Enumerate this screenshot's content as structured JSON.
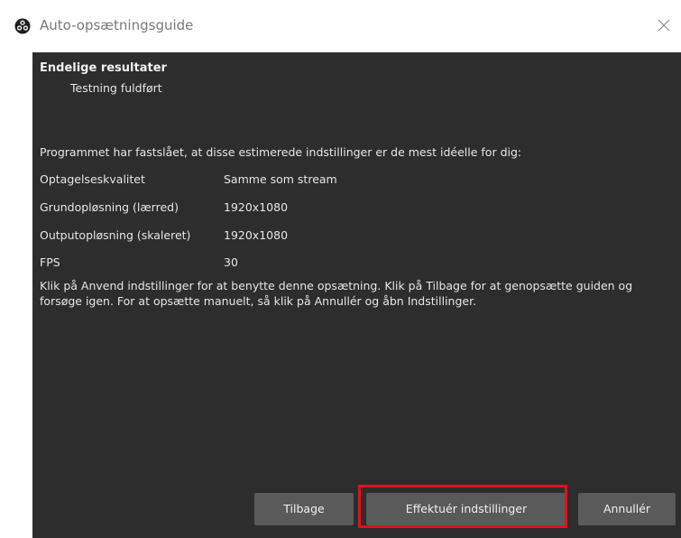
{
  "window": {
    "title": "Auto-opsætningsguide",
    "app_icon": "obs-logo-icon",
    "close_icon": "close-icon"
  },
  "results": {
    "heading": "Endelige resultater",
    "subheading": "Testning fuldført",
    "intro": "Programmet har fastslået, at disse estimerede indstillinger er de mest idéelle for dig:",
    "rows": [
      {
        "label": "Optagelseskvalitet",
        "value": "Samme som stream"
      },
      {
        "label": "Grundopløsning (lærred)",
        "value": "1920x1080"
      },
      {
        "label": "Outputopløsning (skaleret)",
        "value": "1920x1080"
      },
      {
        "label": "FPS",
        "value": "30"
      }
    ],
    "note": "Klik på Anvend indstillinger for at benytte denne opsætning. Klik på Tilbage for at genopsætte guiden og forsøge igen. For at opsætte manuelt, så klik på Annullér og åbn Indstillinger."
  },
  "buttons": {
    "back": "Tilbage",
    "apply": "Effektuér indstillinger",
    "cancel": "Annullér"
  },
  "colors": {
    "content_bg": "#2d2d2d",
    "button_bg": "#5a5a5a",
    "highlight": "#e0121b"
  }
}
